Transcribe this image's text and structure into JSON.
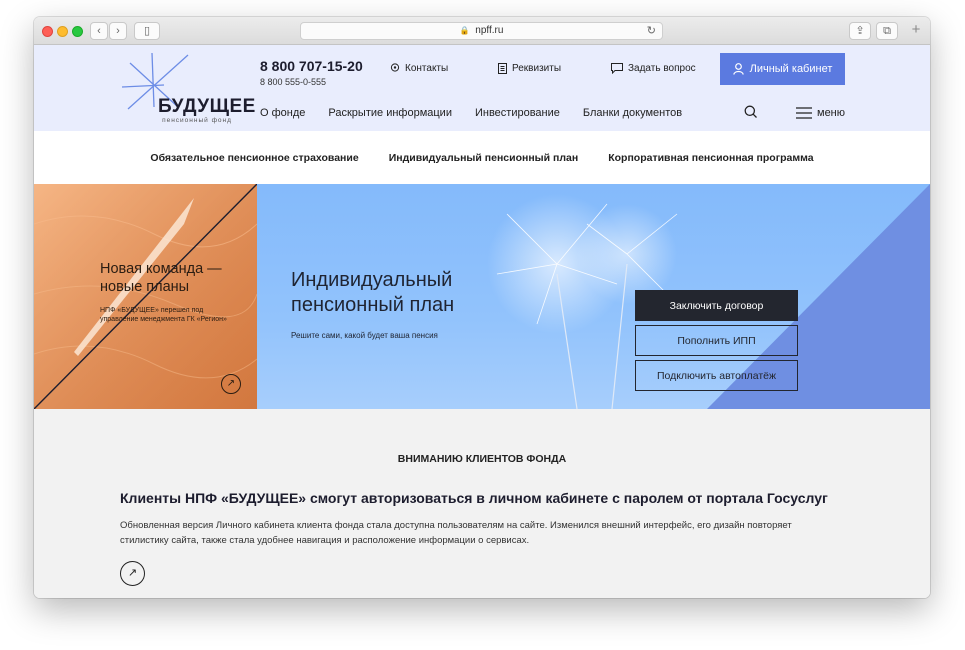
{
  "browser": {
    "url": "npff.ru",
    "back_glyph": "‹",
    "forward_glyph": "›",
    "sidebar_glyph": "▯",
    "share_glyph": "⇪",
    "tabs_glyph": "⧉",
    "new_tab_glyph": "+",
    "reload_glyph": "↻",
    "lock_glyph": "🔒"
  },
  "header": {
    "logo_name": "БУДУЩЕЕ",
    "logo_sub": "пенсионный фонд",
    "phone_main": "8 800 707-15-20",
    "phone_alt": "8 800 555-0-555",
    "top_links": {
      "contacts": "Контакты",
      "requisites": "Реквизиты",
      "question": "Задать вопрос"
    },
    "cabinet_label": "Личный кабинет",
    "nav": [
      "О фонде",
      "Раскрытие информации",
      "Инвестирование",
      "Бланки документов"
    ],
    "menu_label": "меню"
  },
  "subnav": [
    "Обязательное пенсионное страхование",
    "Индивидуальный пенсионный план",
    "Корпоративная пенсионная программа"
  ],
  "promo": {
    "title": "Новая команда — новые планы",
    "text": "НПФ «БУДУЩЕЕ» перешел под управление менеджмента ГК «Регион»",
    "arrow_glyph": "↗"
  },
  "hero": {
    "title": "Индивидуальный пенсионный план",
    "subtitle": "Решите сами, какой будет ваша пенсия",
    "buttons": {
      "contract": "Заключить договор",
      "topup": "Пополнить ИПП",
      "autopay": "Подключить автоплатёж"
    }
  },
  "news": {
    "heading": "ВНИМАНИЮ КЛИЕНТОВ ФОНДА",
    "title": "Клиенты НПФ «БУДУЩЕЕ» смогут авторизоваться в личном кабинете с паролем от портала Госуслуг",
    "text": "Обновленная версия Личного кабинета клиента фонда стала доступна пользователям на сайте. Изменился внешний интерфейс, его дизайн повторяет стилистику сайта, также стала удобнее навигация и расположение информации о сервисах.",
    "arrow_glyph": "↗"
  },
  "colors": {
    "header_bg": "#e9edfd",
    "accent": "#5b7ae0",
    "promo_orange": "#e0884f",
    "hero_blue": "#8bbffb",
    "dark_button": "#23262f"
  },
  "icons": {
    "contacts": "location-pin-icon",
    "requisites": "document-icon",
    "question": "chat-bubble-icon",
    "cabinet": "user-icon",
    "search": "search-icon",
    "menu": "hamburger-icon",
    "arrow": "arrow-up-right-icon"
  }
}
